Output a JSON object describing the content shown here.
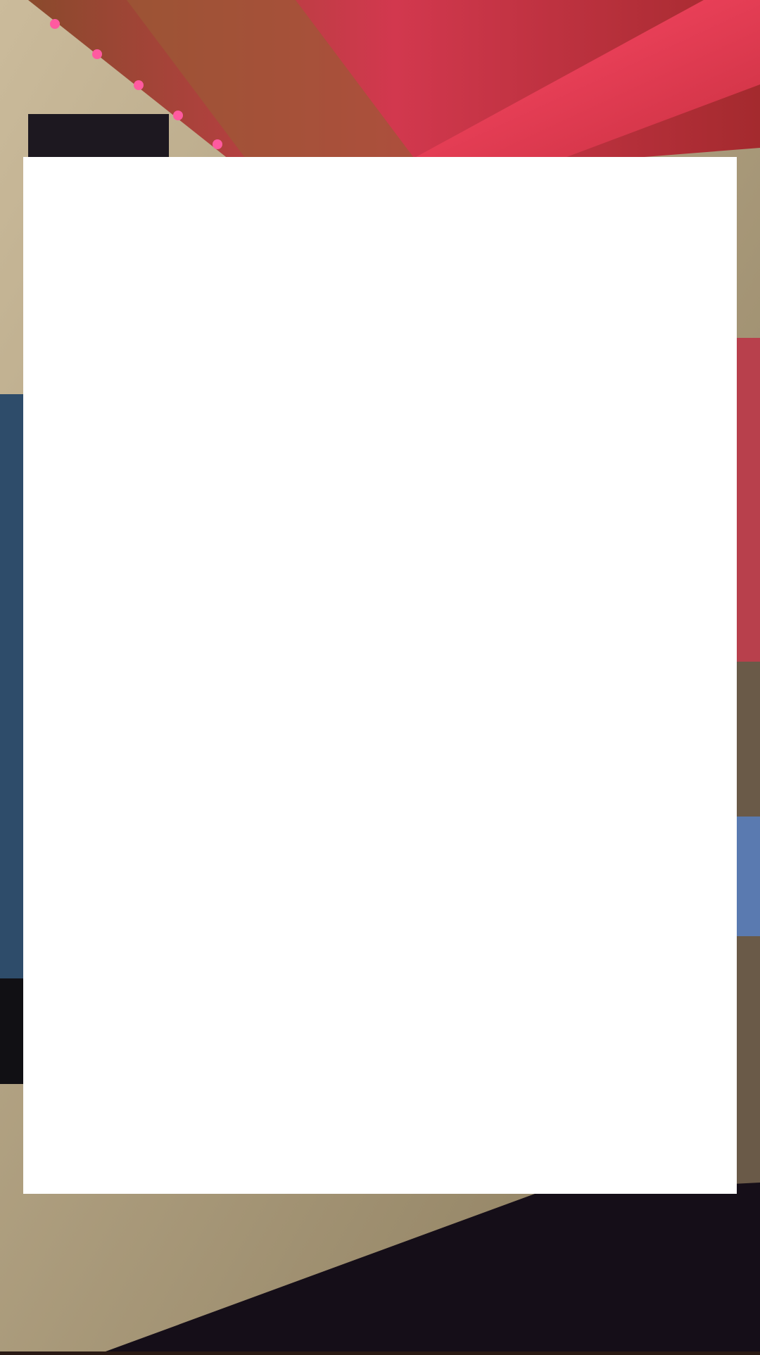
{
  "scene": {
    "description_icon": "photo-background-icon",
    "colors": {
      "wall": "#b8a98a",
      "wall_shadow": "#8c7e62",
      "beam": "#c0443c",
      "beam_highlight": "#ff3a55",
      "ceiling_board": "#a0452b",
      "led": "#ff4f9a",
      "poster_dark": "#1b1620",
      "blanket": "#140e16",
      "panel": "#ffffff"
    }
  }
}
